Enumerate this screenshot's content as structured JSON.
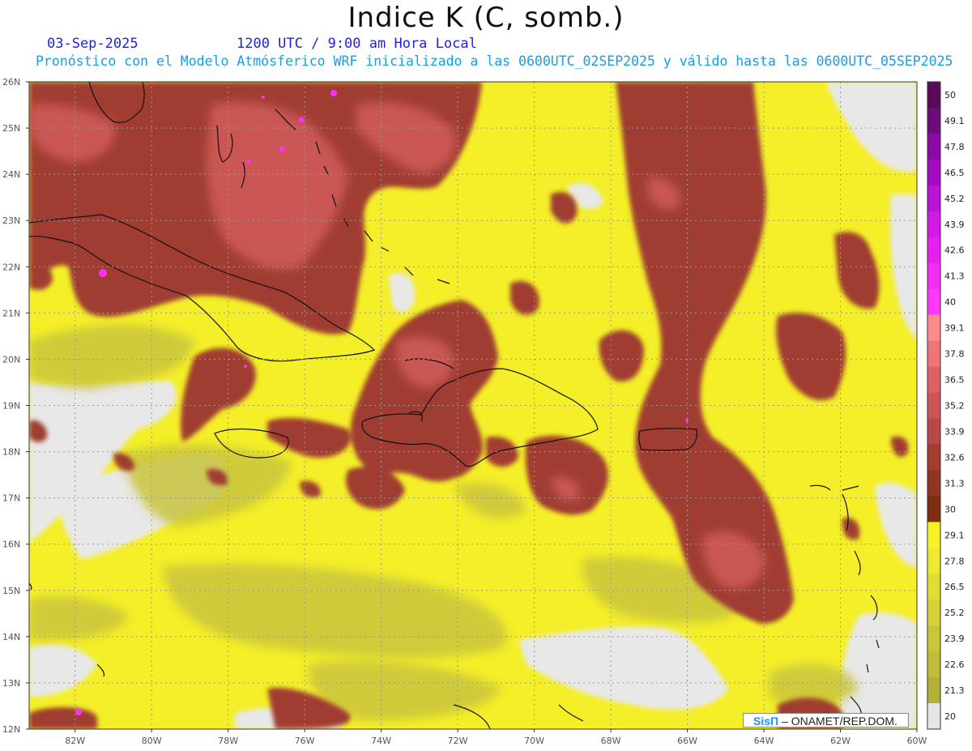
{
  "header": {
    "title": "Indice K (C, somb.)",
    "date": "03-Sep-2025",
    "time": "1200 UTC / 9:00 am Hora Local",
    "description": "Pronóstico con el Modelo Atmósferico WRF inicializado a las 0600UTC_02SEP2025 y válido hasta las  0600UTC_05SEP2025"
  },
  "map": {
    "lat_labels": [
      "26N",
      "25N",
      "24N",
      "23N",
      "22N",
      "21N",
      "20N",
      "19N",
      "18N",
      "17N",
      "16N",
      "15N",
      "14N",
      "13N",
      "12N"
    ],
    "lon_labels": [
      "82W",
      "80W",
      "78W",
      "76W",
      "74W",
      "72W",
      "70W",
      "68W",
      "66W",
      "64W",
      "62W",
      "60W"
    ],
    "lat_range": [
      12,
      26
    ],
    "lon_range": [
      -83.2,
      -60
    ],
    "grid": true
  },
  "legend": {
    "values": [
      "50",
      "49.1",
      "47.8",
      "46.5",
      "45.2",
      "43.9",
      "42.6",
      "41.3",
      "40",
      "39.1",
      "37.8",
      "36.5",
      "35.2",
      "33.9",
      "32.6",
      "31.3",
      "30",
      "29.1",
      "27.8",
      "26.5",
      "25.2",
      "23.9",
      "22.6",
      "21.3",
      "20"
    ],
    "colors": [
      "#5a0a5a",
      "#6b0c7a",
      "#8a0aa8",
      "#a30ac4",
      "#bb12d8",
      "#d21ae6",
      "#e620f0",
      "#f22df5",
      "#ff38ff",
      "#ff8a8a",
      "#f07474",
      "#de6262",
      "#cc5656",
      "#b84848",
      "#a43c30",
      "#8f3520",
      "#7e2e12",
      "#f7f225",
      "#ecea2c",
      "#e0dd33",
      "#d5d23a",
      "#c9c63a",
      "#bfbd3a",
      "#b2b03a",
      "#e6e6e6"
    ]
  },
  "credit": {
    "logo": "SisΠ",
    "text": " – ONAMET/REP.DOM."
  }
}
